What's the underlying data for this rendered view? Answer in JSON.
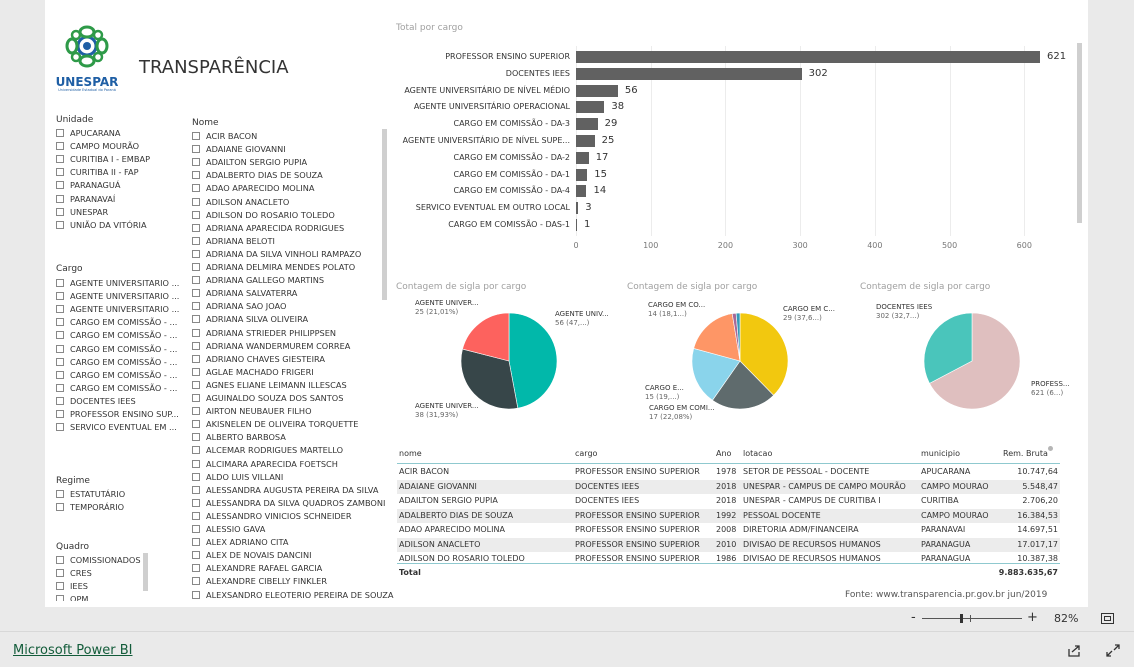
{
  "header": {
    "logo_text": "UNESPAR",
    "logo_sub": "Universidade Estadual do Paraná",
    "title": "TRANSPARÊNCIA"
  },
  "unidade": {
    "label": "Unidade",
    "items": [
      "APUCARANA",
      "CAMPO MOURÃO",
      "CURITIBA I - EMBAP",
      "CURITIBA II - FAP",
      "PARANAGUÁ",
      "PARANAVAÍ",
      "UNESPAR",
      "UNIÃO DA VITÓRIA"
    ]
  },
  "cargo": {
    "label": "Cargo",
    "items": [
      "AGENTE UNIVERSITARIO ...",
      "AGENTE UNIVERSITARIO ...",
      "AGENTE UNIVERSITARIO ...",
      "CARGO EM COMISSÃO - ...",
      "CARGO EM COMISSÃO - ...",
      "CARGO EM COMISSÃO - ...",
      "CARGO EM COMISSÃO - ...",
      "CARGO EM COMISSÃO - ...",
      "CARGO EM COMISSÃO - ...",
      "DOCENTES IEES",
      "PROFESSOR ENSINO SUP...",
      "SERVICO EVENTUAL EM ..."
    ]
  },
  "regime": {
    "label": "Regime",
    "items": [
      "ESTATUTÁRIO",
      "TEMPORÁRIO"
    ]
  },
  "quadro": {
    "label": "Quadro",
    "items": [
      "COMISSIONADOS",
      "CRES",
      "IEES",
      "OPM"
    ]
  },
  "nome": {
    "label": "Nome",
    "items": [
      "ACIR BACON",
      "ADAIANE GIOVANNI",
      "ADAILTON SERGIO PUPIA",
      "ADALBERTO DIAS DE SOUZA",
      "ADAO APARECIDO MOLINA",
      "ADILSON ANACLETO",
      "ADILSON DO ROSARIO TOLEDO",
      "ADRIANA APARECIDA RODRIGUES",
      "ADRIANA BELOTI",
      "ADRIANA DA SILVA VINHOLI RAMPAZO",
      "ADRIANA DELMIRA MENDES POLATO",
      "ADRIANA GALLEGO MARTINS",
      "ADRIANA SALVATERRA",
      "ADRIANA SAO JOAO",
      "ADRIANA SILVA OLIVEIRA",
      "ADRIANA STRIEDER PHILIPPSEN",
      "ADRIANA WANDERMUREM CORREA",
      "ADRIANO CHAVES GIESTEIRA",
      "AGLAE MACHADO FRIGERI",
      "AGNES ELIANE LEIMANN ILLESCAS",
      "AGUINALDO SOUZA DOS SANTOS",
      "AIRTON NEUBAUER FILHO",
      "AKISNELEN DE OLIVEIRA TORQUETTE",
      "ALBERTO BARBOSA",
      "ALCEMAR RODRIGUES MARTELLO",
      "ALCIMARA APARECIDA FOETSCH",
      "ALDO LUIS VILLANI",
      "ALESSANDRA AUGUSTA PEREIRA DA SILVA",
      "ALESSANDRA DA SILVA QUADROS ZAMBONI",
      "ALESSANDRO VINICIOS SCHNEIDER",
      "ALESSIO GAVA",
      "ALEX ADRIANO CITA",
      "ALEX DE NOVAIS DANCINI",
      "ALEXANDRE RAFAEL GARCIA",
      "ALEXANDRE CIBELLY FINKLER",
      "ALEXSANDRO ELEOTERIO PEREIRA DE SOUZA"
    ]
  },
  "chart_data": [
    {
      "type": "bar",
      "title": "Total por cargo",
      "categories": [
        "PROFESSOR ENSINO SUPERIOR",
        "DOCENTES IEES",
        "AGENTE UNIVERSITÁRIO DE NÍVEL MÉDIO",
        "AGENTE UNIVERSITÁRIO OPERACIONAL",
        "CARGO EM COMISSÃO - DA-3",
        "AGENTE UNIVERSITÁRIO DE NÍVEL SUPE...",
        "CARGO EM COMISSÃO - DA-2",
        "CARGO EM COMISSÃO - DA-1",
        "CARGO EM COMISSÃO - DA-4",
        "SERVICO EVENTUAL EM OUTRO LOCAL",
        "CARGO EM COMISSÃO - DAS-1"
      ],
      "values": [
        621,
        302,
        56,
        38,
        29,
        25,
        17,
        15,
        14,
        3,
        1
      ],
      "xlim": [
        0,
        650
      ],
      "ticks": [
        0,
        100,
        200,
        300,
        400,
        500,
        600
      ],
      "color": "#616161"
    },
    {
      "type": "pie",
      "title": "Contagem de sigla por cargo",
      "slices": [
        {
          "label": "AGENTE UNIV...",
          "count": "56 (47,...)",
          "value": 56,
          "color": "#01B8AA"
        },
        {
          "label": "AGENTE UNIVER...",
          "count": "38 (31,93%)",
          "value": 38,
          "color": "#374649"
        },
        {
          "label": "AGENTE UNIVER...",
          "count": "25 (21,01%)",
          "value": 25,
          "color": "#FD625E"
        }
      ]
    },
    {
      "type": "pie",
      "title": "Contagem de sigla por cargo",
      "slices": [
        {
          "label": "CARGO EM C...",
          "count": "29 (37,6...)",
          "value": 29,
          "color": "#F2C80F"
        },
        {
          "label": "CARGO EM COMI...",
          "count": "17 (22,08%)",
          "value": 17,
          "color": "#5F6B6D"
        },
        {
          "label": "CARGO E...",
          "count": "15 (19,...)",
          "value": 15,
          "color": "#8AD4EB"
        },
        {
          "label": "CARGO EM CO...",
          "count": "14 (18,1...)",
          "value": 14,
          "color": "#FE9666"
        },
        {
          "label": "",
          "count": "",
          "value": 1,
          "color": "#A66999"
        },
        {
          "label": "",
          "count": "",
          "value": 1,
          "color": "#3599B8"
        }
      ]
    },
    {
      "type": "pie",
      "title": "Contagem de sigla por cargo",
      "slices": [
        {
          "label": "PROFESS...",
          "count": "621 (6...)",
          "value": 621,
          "color": "#DFBFBF"
        },
        {
          "label": "DOCENTES IEES",
          "count": "302 (32,7...)",
          "value": 302,
          "color": "#4AC5BB"
        }
      ]
    }
  ],
  "table": {
    "headers": [
      "nome",
      "cargo",
      "Ano",
      "lotacao",
      "municipio",
      "Rem. Bruta"
    ],
    "rows": [
      [
        "ACIR BACON",
        "PROFESSOR ENSINO SUPERIOR",
        "1978",
        "SETOR DE PESSOAL - DOCENTE",
        "APUCARANA",
        "10.747,64"
      ],
      [
        "ADAIANE GIOVANNI",
        "DOCENTES IEES",
        "2018",
        "UNESPAR - CAMPUS DE CAMPO MOURÃO",
        "CAMPO MOURAO",
        "5.548,47"
      ],
      [
        "ADAILTON SERGIO PUPIA",
        "DOCENTES IEES",
        "2018",
        "UNESPAR - CAMPUS DE CURITIBA I",
        "CURITIBA",
        "2.706,20"
      ],
      [
        "ADALBERTO DIAS DE SOUZA",
        "PROFESSOR ENSINO SUPERIOR",
        "1992",
        "PESSOAL DOCENTE",
        "CAMPO MOURAO",
        "16.384,53"
      ],
      [
        "ADAO APARECIDO MOLINA",
        "PROFESSOR ENSINO SUPERIOR",
        "2008",
        "DIRETORIA ADM/FINANCEIRA",
        "PARANAVAI",
        "14.697,51"
      ],
      [
        "ADILSON ANACLETO",
        "PROFESSOR ENSINO SUPERIOR",
        "2010",
        "DIVISAO DE RECURSOS HUMANOS",
        "PARANAGUA",
        "17.017,17"
      ],
      [
        "ADILSON DO ROSARIO TOLEDO",
        "PROFESSOR ENSINO SUPERIOR",
        "1986",
        "DIVISAO DE RECURSOS HUMANOS",
        "PARANAGUA",
        "10.387,38"
      ]
    ],
    "total_label": "Total",
    "total_value": "9.883.635,67"
  },
  "source": "Fonte: www.transparencia.pr.gov.br jun/2019",
  "zoom": {
    "minus": "-",
    "plus": "+",
    "value": "82%",
    "level_percent": 82
  },
  "footer": {
    "brand": "Microsoft Power BI"
  }
}
